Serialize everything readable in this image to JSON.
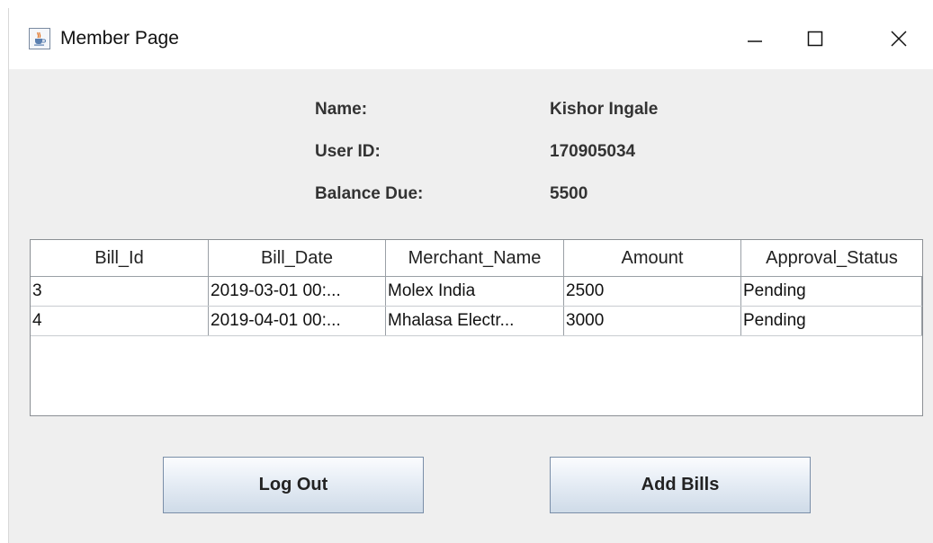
{
  "window": {
    "title": "Member Page",
    "app_icon": "java-cup-icon"
  },
  "controls": {
    "minimize": "minimize-icon",
    "maximize": "maximize-icon",
    "close": "close-icon"
  },
  "member": {
    "name_label": "Name:",
    "name_value": "Kishor Ingale",
    "userid_label": "User ID:",
    "userid_value": "170905034",
    "balance_label": "Balance Due:",
    "balance_value": "5500"
  },
  "table": {
    "columns": [
      "Bill_Id",
      "Bill_Date",
      "Merchant_Name",
      "Amount",
      "Approval_Status"
    ],
    "rows": [
      [
        "3",
        "2019-03-01 00:...",
        "Molex India",
        "2500",
        "Pending"
      ],
      [
        "4",
        "2019-04-01 00:...",
        "Mhalasa Electr...",
        "3000",
        "Pending"
      ]
    ]
  },
  "buttons": {
    "logout_label": "Log Out",
    "add_bills_label": "Add Bills"
  }
}
